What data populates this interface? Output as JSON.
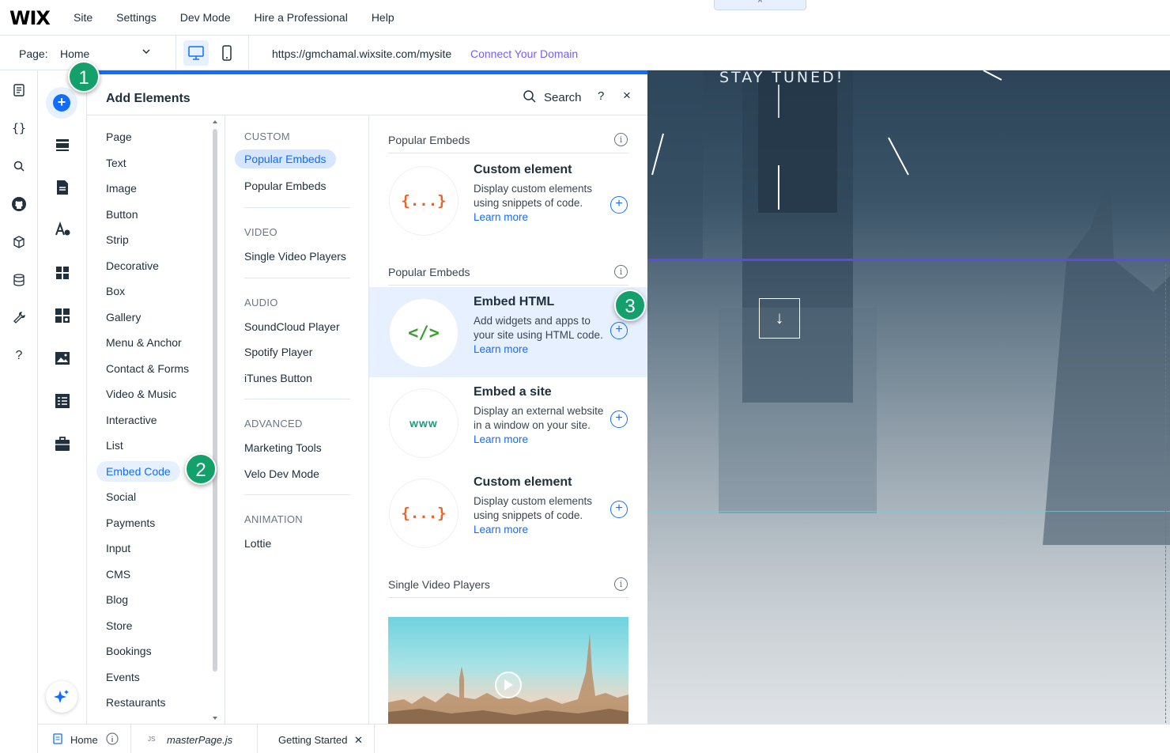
{
  "topbar": {
    "logo": "WIX",
    "menu": [
      "Site",
      "Settings",
      "Dev Mode",
      "Hire a Professional",
      "Help"
    ],
    "collapse_tab": "^"
  },
  "pagebar": {
    "page_label": "Page:",
    "page_value": "Home",
    "url": "https://gmchamal.wixsite.com/mysite",
    "connect_domain": "Connect Your Domain"
  },
  "panel": {
    "title": "Add Elements",
    "search_label": "Search",
    "help": "?",
    "close": "×",
    "categories": [
      "Page",
      "Text",
      "Image",
      "Button",
      "Strip",
      "Decorative",
      "Box",
      "Gallery",
      "Menu & Anchor",
      "Contact & Forms",
      "Video & Music",
      "Interactive",
      "List",
      "Embed Code",
      "Social",
      "Payments",
      "Input",
      "CMS",
      "Blog",
      "Store",
      "Bookings",
      "Events",
      "Restaurants"
    ],
    "active_category": "Embed Code",
    "subcategories": {
      "custom_head": "CUSTOM",
      "custom_items": [
        "Popular Embeds",
        "Popular Embeds"
      ],
      "video_head": "VIDEO",
      "video_items": [
        "Single Video Players"
      ],
      "audio_head": "AUDIO",
      "audio_items": [
        "SoundCloud Player",
        "Spotify Player",
        "iTunes Button"
      ],
      "advanced_head": "ADVANCED",
      "advanced_items": [
        "Marketing Tools",
        "Velo Dev Mode"
      ],
      "animation_head": "ANIMATION",
      "animation_items": [
        "Lottie"
      ]
    },
    "sections": [
      {
        "title": "Popular Embeds"
      },
      {
        "title": "Popular Embeds"
      },
      {
        "title": "Single Video Players"
      }
    ],
    "info_glyph": "i",
    "cards": [
      {
        "icon": "{...}",
        "title": "Custom element",
        "desc": "Display custom elements using snippets of code. ",
        "link": "Learn more"
      },
      {
        "icon": "</>",
        "title": "Embed HTML",
        "desc": "Add widgets and apps to your site using HTML code. ",
        "link": "Learn more"
      },
      {
        "icon": "www",
        "title": "Embed a site",
        "desc": "Display an external website in a window on your site. ",
        "link": "Learn more"
      },
      {
        "icon": "{...}",
        "title": "Custom element",
        "desc": "Display custom elements using snippets of code. ",
        "link": "Learn more"
      }
    ],
    "add_glyph": "+"
  },
  "canvas": {
    "headline": "STAY TUNED!",
    "down_arrow": "↓"
  },
  "bottombar": {
    "tabs": [
      "Home",
      "masterPage.js",
      "Getting Started"
    ],
    "js_badge": "JS",
    "close": "✕"
  },
  "markers": [
    "1",
    "2",
    "3"
  ],
  "colors": {
    "accent": "#116dff",
    "marker": "#14a06a",
    "highlight": "#e7f0ff",
    "connect": "#7a5cf6"
  }
}
